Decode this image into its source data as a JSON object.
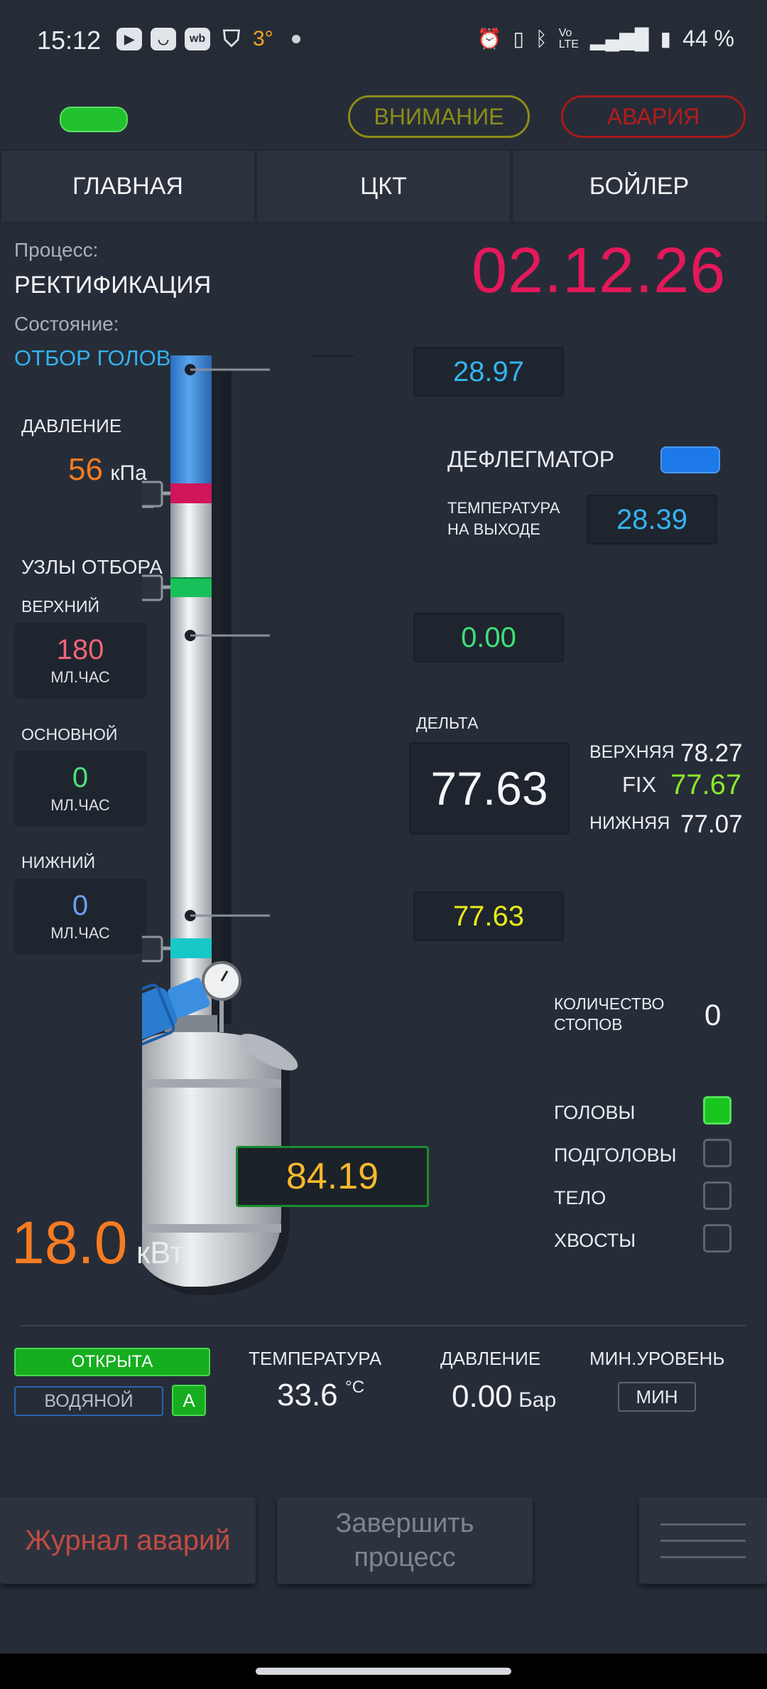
{
  "status_bar": {
    "time": "15:12",
    "temp": "3°",
    "battery": "44 %",
    "icons": [
      "youtube-icon",
      "mail-icon",
      "wb-icon",
      "shield-icon",
      "alarm-icon",
      "vibrate-icon",
      "bluetooth-icon",
      "volte-icon",
      "signal-icon",
      "battery-icon"
    ]
  },
  "header": {
    "warning_label": "ВНИМАНИЕ",
    "alarm_label": "АВАРИЯ",
    "colors": {
      "ok": "#22c22e",
      "warning": "#8d8c19",
      "alarm": "#b51c1c"
    }
  },
  "tabs": [
    {
      "label": "ГЛАВНАЯ"
    },
    {
      "label": "ЦКТ"
    },
    {
      "label": "БОЙЛЕР"
    }
  ],
  "process": {
    "process_label": "Процесс:",
    "process_value": "РЕКТИФИКАЦИЯ",
    "state_label": "Состояние:",
    "state_value": "ОТБОР ГОЛОВ",
    "timer": "02.12.26"
  },
  "pressure": {
    "label": "ДАВЛЕНИЕ",
    "value": "56",
    "unit": "кПа"
  },
  "takeoff": {
    "title": "УЗЛЫ ОТБОРА",
    "upper": {
      "label": "ВЕРХНИЙ",
      "value": "180",
      "unit": "МЛ.ЧАС"
    },
    "main": {
      "label": "ОСНОВНОЙ",
      "value": "0",
      "unit": "МЛ.ЧАС"
    },
    "lower": {
      "label": "НИЖНИЙ",
      "value": "0",
      "unit": "МЛ.ЧАС"
    }
  },
  "column": {
    "top_temp": "28.97",
    "mid_temp": "0.00",
    "bottom_temp": "77.63",
    "kettle_temp": "84.19"
  },
  "dephlegmator": {
    "label": "ДЕФЛЕГМАТОР",
    "outlet_label_1": "ТЕМПЕРАТУРА",
    "outlet_label_2": "НА ВЫХОДЕ",
    "outlet_temp": "28.39"
  },
  "delta": {
    "label": "ДЕЛЬТА",
    "value": "77.63",
    "upper_label": "ВЕРХНЯЯ",
    "upper_value": "78.27",
    "fix_label": "FIX",
    "fix_value": "77.67",
    "lower_label": "НИЖНЯЯ",
    "lower_value": "77.07"
  },
  "stops": {
    "label_1": "КОЛИЧЕСТВО",
    "label_2": "СТОПОВ",
    "value": "0"
  },
  "fractions": [
    {
      "label": "ГОЛОВЫ",
      "checked": true
    },
    {
      "label": "ПОДГОЛОВЫ",
      "checked": false
    },
    {
      "label": "ТЕЛО",
      "checked": false
    },
    {
      "label": "ХВОСТЫ",
      "checked": false
    }
  ],
  "power": {
    "value": "18.0",
    "unit": "кВт"
  },
  "water": {
    "valve_state": "ОТКРЫТА",
    "mode": "ВОДЯНОЙ",
    "auto": "А",
    "temp_label": "ТЕМПЕРАТУРА",
    "temp_value": "33.6",
    "temp_unit": "°C",
    "pressure_label": "ДАВЛЕНИЕ",
    "pressure_value": "0.00",
    "pressure_unit": "Бар",
    "level_label": "МИН.УРОВЕНЬ",
    "level_value": "МИН"
  },
  "footer": {
    "alarm_log": "Журнал аварий",
    "finish_1": "Завершить",
    "finish_2": "процесс"
  }
}
